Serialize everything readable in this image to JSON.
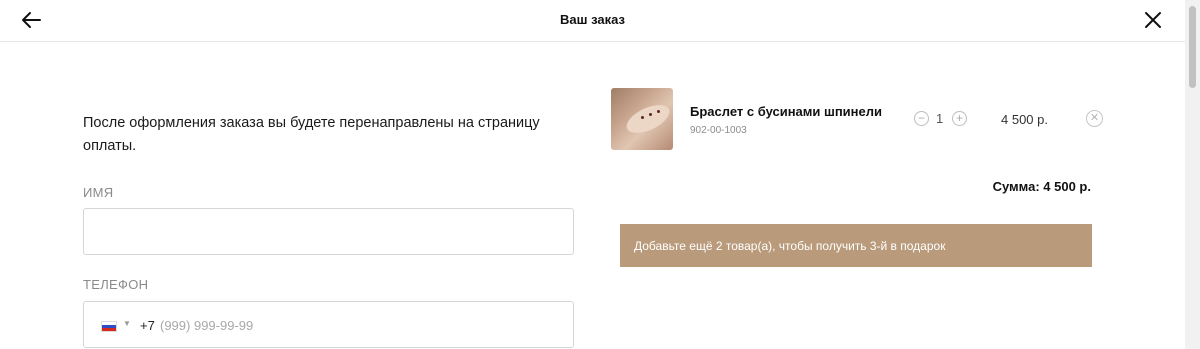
{
  "header": {
    "title": "Ваш заказ",
    "back_icon": "arrow-left-icon",
    "close_icon": "close-icon"
  },
  "form": {
    "notice": "После оформления заказа вы будете перенаправлены на страницу оплаты.",
    "name_label": "ИМЯ",
    "name_value": "",
    "phone_label": "ТЕЛЕФОН",
    "phone_country_code": "+7",
    "phone_placeholder": "(999) 999-99-99",
    "phone_flag": "russia-flag-icon"
  },
  "cart": {
    "items": [
      {
        "name": "Браслет с бусинами шпинели",
        "sku": "902-00-1003",
        "quantity": "1",
        "price": "4 500 р."
      }
    ],
    "sum_text": "Сумма: 4 500 р.",
    "promo_text": "Добавьте ещё 2 товар(а), чтобы получить 3-й в подарок"
  },
  "colors": {
    "promo_background": "#b99a7b",
    "text_primary": "#111111",
    "label_gray": "#8a8a8a"
  }
}
